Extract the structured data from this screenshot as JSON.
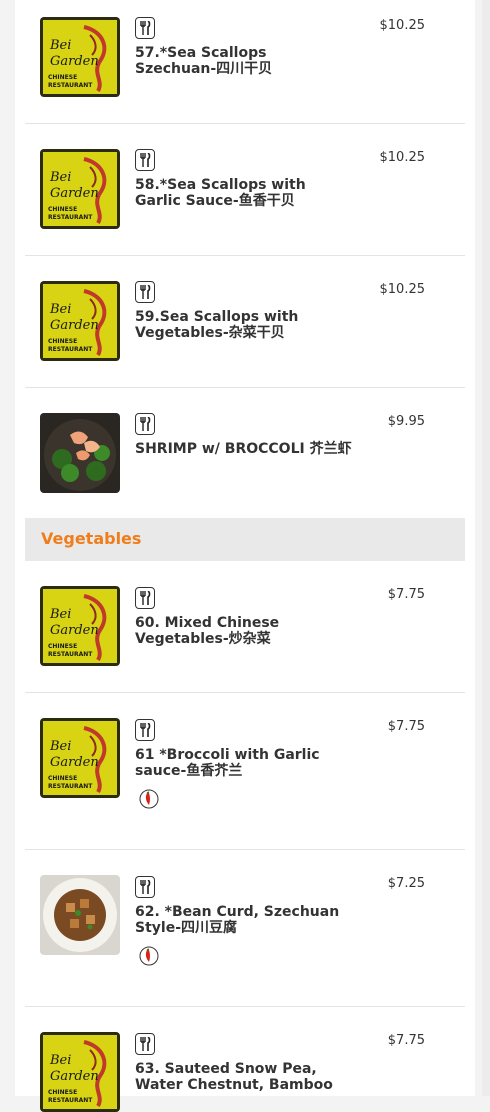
{
  "items_top": [
    {
      "name": "57.*Sea Scallops Szechuan-四川干贝",
      "price": "$10.25",
      "image": "restaurant-logo",
      "spicy": false
    },
    {
      "name": "58.*Sea Scallops with Garlic Sauce-鱼香干贝",
      "price": "$10.25",
      "image": "restaurant-logo",
      "spicy": false
    },
    {
      "name": "59.Sea Scallops with Vegetables-杂菜干贝",
      "price": "$10.25",
      "image": "restaurant-logo",
      "spicy": false
    },
    {
      "name": "SHRIMP w/ BROCCOLI 芥兰虾",
      "price": "$9.95",
      "image": "shrimp-broccoli-photo",
      "spicy": false
    }
  ],
  "category": {
    "title": "Vegetables"
  },
  "items_veg": [
    {
      "name": "60. Mixed Chinese Vegetables-炒杂菜",
      "price": "$7.75",
      "image": "restaurant-logo",
      "spicy": false
    },
    {
      "name": "61 *Broccoli with Garlic sauce-鱼香芥兰",
      "price": "$7.75",
      "image": "restaurant-logo",
      "spicy": true
    },
    {
      "name": "62. *Bean Curd, Szechuan Style-四川豆腐",
      "price": "$7.25",
      "image": "bean-curd-photo",
      "spicy": true
    },
    {
      "name": "63. Sauteed Snow Pea, Water Chestnut, Bamboo",
      "price": "$7.75",
      "image": "restaurant-logo",
      "spicy": false
    }
  ],
  "icons": {
    "utensil": "fork-knife-icon",
    "spicy": "chili-pepper-icon"
  },
  "colors": {
    "category_title": "#f07d1b",
    "logo_bg": "#d8d414",
    "logo_text": "#c0392b"
  }
}
